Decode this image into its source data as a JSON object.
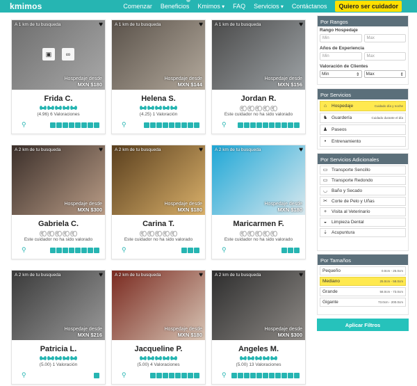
{
  "header": {
    "logo": "kmimos",
    "nav": [
      "Comenzar",
      "Beneficios",
      "Kmimos",
      "FAQ",
      "Servicios",
      "Contáctanos"
    ],
    "cta": "Quiero ser cuidador"
  },
  "cards": [
    {
      "name": "Frida C.",
      "distance": "A 1 km de tu busqueda",
      "price_label": "Hospedaje desde",
      "price": "MXN $180",
      "bones": 5,
      "rating_text": "(4.96) 6 Valoraciones",
      "services": 8,
      "photo": [
        "#6e6e6e",
        "#a9a9a9"
      ]
    },
    {
      "name": "Helena S.",
      "distance": "A 1 km de tu busqueda",
      "price_label": "Hospedaje desde",
      "price": "MXN $144",
      "bones": 5,
      "rating_text": "(4.25) 1 Valoración",
      "services": 9,
      "photo": [
        "#5a524a",
        "#b3a99c"
      ]
    },
    {
      "name": "Jordan R.",
      "distance": "A 1 km de tu busqueda",
      "price_label": "Hospedaje desde",
      "price": "MXN $156",
      "bones": 0,
      "rating_text": "Este cuidador no ha sido valorado",
      "services": 10,
      "photo": [
        "#4a4a4a",
        "#9ea3a6"
      ]
    },
    {
      "name": "Gabriela C.",
      "distance": "A 2 km de tu busqueda",
      "price_label": "Hospedaje desde",
      "price": "MXN $300",
      "bones": 0,
      "rating_text": "Este cuidador no ha sido valorado",
      "services": 8,
      "photo": [
        "#3b2f2a",
        "#b99c86"
      ]
    },
    {
      "name": "Carina T.",
      "distance": "A 2 km de tu busqueda",
      "price_label": "Hospedaje desde",
      "price": "MXN $180",
      "bones": 0,
      "rating_text": "Este cuidador no ha sido valorado",
      "services": 3,
      "photo": [
        "#5a3f1e",
        "#d9b06a"
      ]
    },
    {
      "name": "Maricarmen F.",
      "distance": "A 2 km de tu busqueda",
      "price_label": "Hospedaje desde",
      "price": "MXN $180",
      "bones": 0,
      "rating_text": "Este cuidador no ha sido valorado",
      "services": 3,
      "photo": [
        "#1fa7d6",
        "#d8e8ee"
      ]
    },
    {
      "name": "Patricia L.",
      "distance": "A 2 km de tu busqueda",
      "price_label": "Hospedaje desde",
      "price": "MXN $216",
      "bones": 5,
      "rating_text": "(5.00) 1 Valoración",
      "services": 1,
      "photo": [
        "#3a3a3a",
        "#9a9a9a"
      ]
    },
    {
      "name": "Jacqueline P.",
      "distance": "A 2 km de tu busqueda",
      "price_label": "Hospedaje desde",
      "price": "MXN $180",
      "bones": 5,
      "rating_text": "(5.00) 4 Valoraciones",
      "services": 8,
      "photo": [
        "#7a2a20",
        "#d7c4b4"
      ]
    },
    {
      "name": "Angeles M.",
      "distance": "A 2 km de tu busqueda",
      "price_label": "Hospedaje desde",
      "price": "MXN $300",
      "bones": 5,
      "rating_text": "(5.00) 13 Valoraciones",
      "services": 11,
      "photo": [
        "#2d2d2d",
        "#8e8a86"
      ]
    }
  ],
  "sidebar": {
    "rangos": {
      "title": "Por Rangos",
      "hospedaje_label": "Rango Hospedaje",
      "exp_label": "Años de Experiencia",
      "val_label": "Valoración de Clientes",
      "min_ph": "Min",
      "max_ph": "Max",
      "min_sel": "Min",
      "max_sel": "Max"
    },
    "servicios": {
      "title": "Por Servicios",
      "items": [
        {
          "label": "Hospedaje",
          "desc": "Cuidado día y noche",
          "icon": "home-icon",
          "glyph": "⌂",
          "hl": true
        },
        {
          "label": "Guardería",
          "desc": "Cuidado durante el día",
          "icon": "dog-icon",
          "glyph": "♞",
          "hl": false
        },
        {
          "label": "Paseos",
          "desc": "",
          "icon": "walk-icon",
          "glyph": "♟",
          "hl": false
        },
        {
          "label": "Entrenamiento",
          "desc": "",
          "icon": "training-icon",
          "glyph": "•",
          "hl": false
        }
      ]
    },
    "adicionales": {
      "title": "Por Servicios Adicionales",
      "items": [
        {
          "label": "Transporte Sencillo",
          "icon": "car-icon",
          "glyph": "▭"
        },
        {
          "label": "Transporte Redondo",
          "icon": "car-icon",
          "glyph": "▭"
        },
        {
          "label": "Baño y Secado",
          "icon": "bath-icon",
          "glyph": "◡"
        },
        {
          "label": "Corte de Pelo y Uñas",
          "icon": "scissors-icon",
          "glyph": "✂"
        },
        {
          "label": "Visita al Veterinario",
          "icon": "vet-icon",
          "glyph": "+"
        },
        {
          "label": "Limpieza Dental",
          "icon": "tooth-icon",
          "glyph": "◒"
        },
        {
          "label": "Acupuntura",
          "icon": "needle-icon",
          "glyph": "⇣"
        }
      ]
    },
    "tamanos": {
      "title": "Por Tamaños",
      "items": [
        {
          "label": "Pequeño",
          "desc": "0.0cm - 25.0cm",
          "hl": false
        },
        {
          "label": "Mediano",
          "desc": "25.0cm - 58.0cm",
          "hl": true
        },
        {
          "label": "Grande",
          "desc": "58.0cm - 73.0cm",
          "hl": false
        },
        {
          "label": "Gigante",
          "desc": "73.0cm - 200.0cm",
          "hl": false
        }
      ]
    },
    "apply": "Aplicar Filtros"
  },
  "colors": {
    "accent": "#26b5b2",
    "cta": "#ffe000",
    "sidebar_head": "#5b6f7a"
  }
}
